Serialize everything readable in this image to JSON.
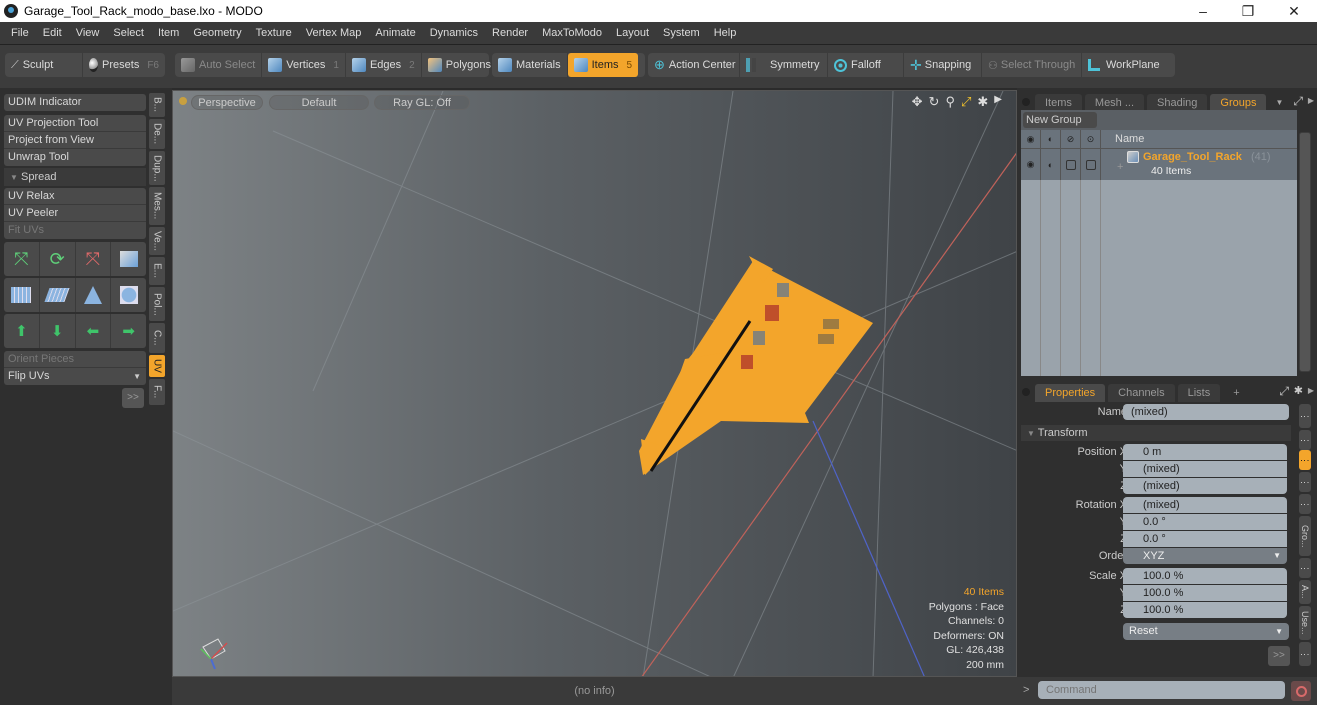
{
  "window": {
    "title": "Garage_Tool_Rack_modo_base.lxo - MODO",
    "minimize": "–",
    "restore": "❐",
    "close": "✕"
  },
  "menu": [
    "File",
    "Edit",
    "View",
    "Select",
    "Item",
    "Geometry",
    "Texture",
    "Vertex Map",
    "Animate",
    "Dynamics",
    "Render",
    "MaxToModo",
    "Layout",
    "System",
    "Help"
  ],
  "toolbar": {
    "sculpt": "Sculpt",
    "presets": "Presets",
    "presets_key": "F6",
    "auto_select": "Auto Select",
    "vertices": "Vertices",
    "vertices_key": "1",
    "edges": "Edges",
    "edges_key": "2",
    "polygons": "Polygons",
    "materials": "Materials",
    "items": "Items",
    "items_key": "5",
    "action_center": "Action Center",
    "symmetry": "Symmetry",
    "falloff": "Falloff",
    "snapping": "Snapping",
    "select_through": "Select Through",
    "workplane": "WorkPlane"
  },
  "left_panel": {
    "udim": "UDIM Indicator",
    "tools": [
      "UV Projection Tool",
      "Project from View",
      "Unwrap Tool"
    ],
    "spread": "Spread",
    "tools2": [
      "UV Relax",
      "UV Peeler",
      "Fit UVs"
    ],
    "orient": "Orient Pieces",
    "flip": "Flip UVs",
    "more": ">>",
    "vtabs": [
      "B...",
      "De...",
      "Dup...",
      "Mes...",
      "Ve...",
      "E...",
      "Pol...",
      "C...",
      "UV",
      "F..."
    ]
  },
  "viewport": {
    "view": "Perspective",
    "shading": "Default",
    "raygl": "Ray GL: Off",
    "stats": {
      "items": "40 Items",
      "polygons": "Polygons : Face",
      "channels": "Channels: 0",
      "deformers": "Deformers: ON",
      "gl": "GL: 426,438",
      "scale": "200 mm"
    },
    "info": "(no info)"
  },
  "groups_panel": {
    "tabs": [
      "Items",
      "Mesh ...",
      "Shading",
      "Groups"
    ],
    "active_tab": "Groups",
    "new_group": "New Group",
    "name_header": "Name",
    "group_name": "Garage_Tool_Rack",
    "group_count": "(41)",
    "group_sub": "40 Items"
  },
  "properties": {
    "tabs": [
      "Properties",
      "Channels",
      "Lists",
      "+"
    ],
    "name_label": "Name",
    "name_value": "(mixed)",
    "transform": "Transform",
    "rows": [
      {
        "label": "Position X",
        "value": "0 m",
        "dot": "gray"
      },
      {
        "label": "Y",
        "value": "(mixed)",
        "dot": "gray"
      },
      {
        "label": "Z",
        "value": "(mixed)",
        "dot": "gray"
      },
      {
        "label": "Rotation X",
        "value": "(mixed)",
        "dot": "blue"
      },
      {
        "label": "Y",
        "value": "0.0 °",
        "dot": "blue"
      },
      {
        "label": "Z",
        "value": "0.0 °",
        "dot": "blue"
      },
      {
        "label": "Order",
        "value": "XYZ",
        "dot": "gray"
      },
      {
        "label": "Scale X",
        "value": "100.0 %",
        "dot": "gray"
      },
      {
        "label": "Y",
        "value": "100.0 %",
        "dot": "gray"
      },
      {
        "label": "Z",
        "value": "100.0 %",
        "dot": "gray"
      }
    ],
    "reset": "Reset",
    "more": ">>",
    "side_tabs": [
      "Gro...",
      "A...",
      "Use..."
    ]
  },
  "command": {
    "prompt": ">",
    "placeholder": "Command"
  },
  "colors": {
    "accent": "#f3a52b",
    "panel": "#4a4a4a",
    "background": "#2f2f2f"
  }
}
